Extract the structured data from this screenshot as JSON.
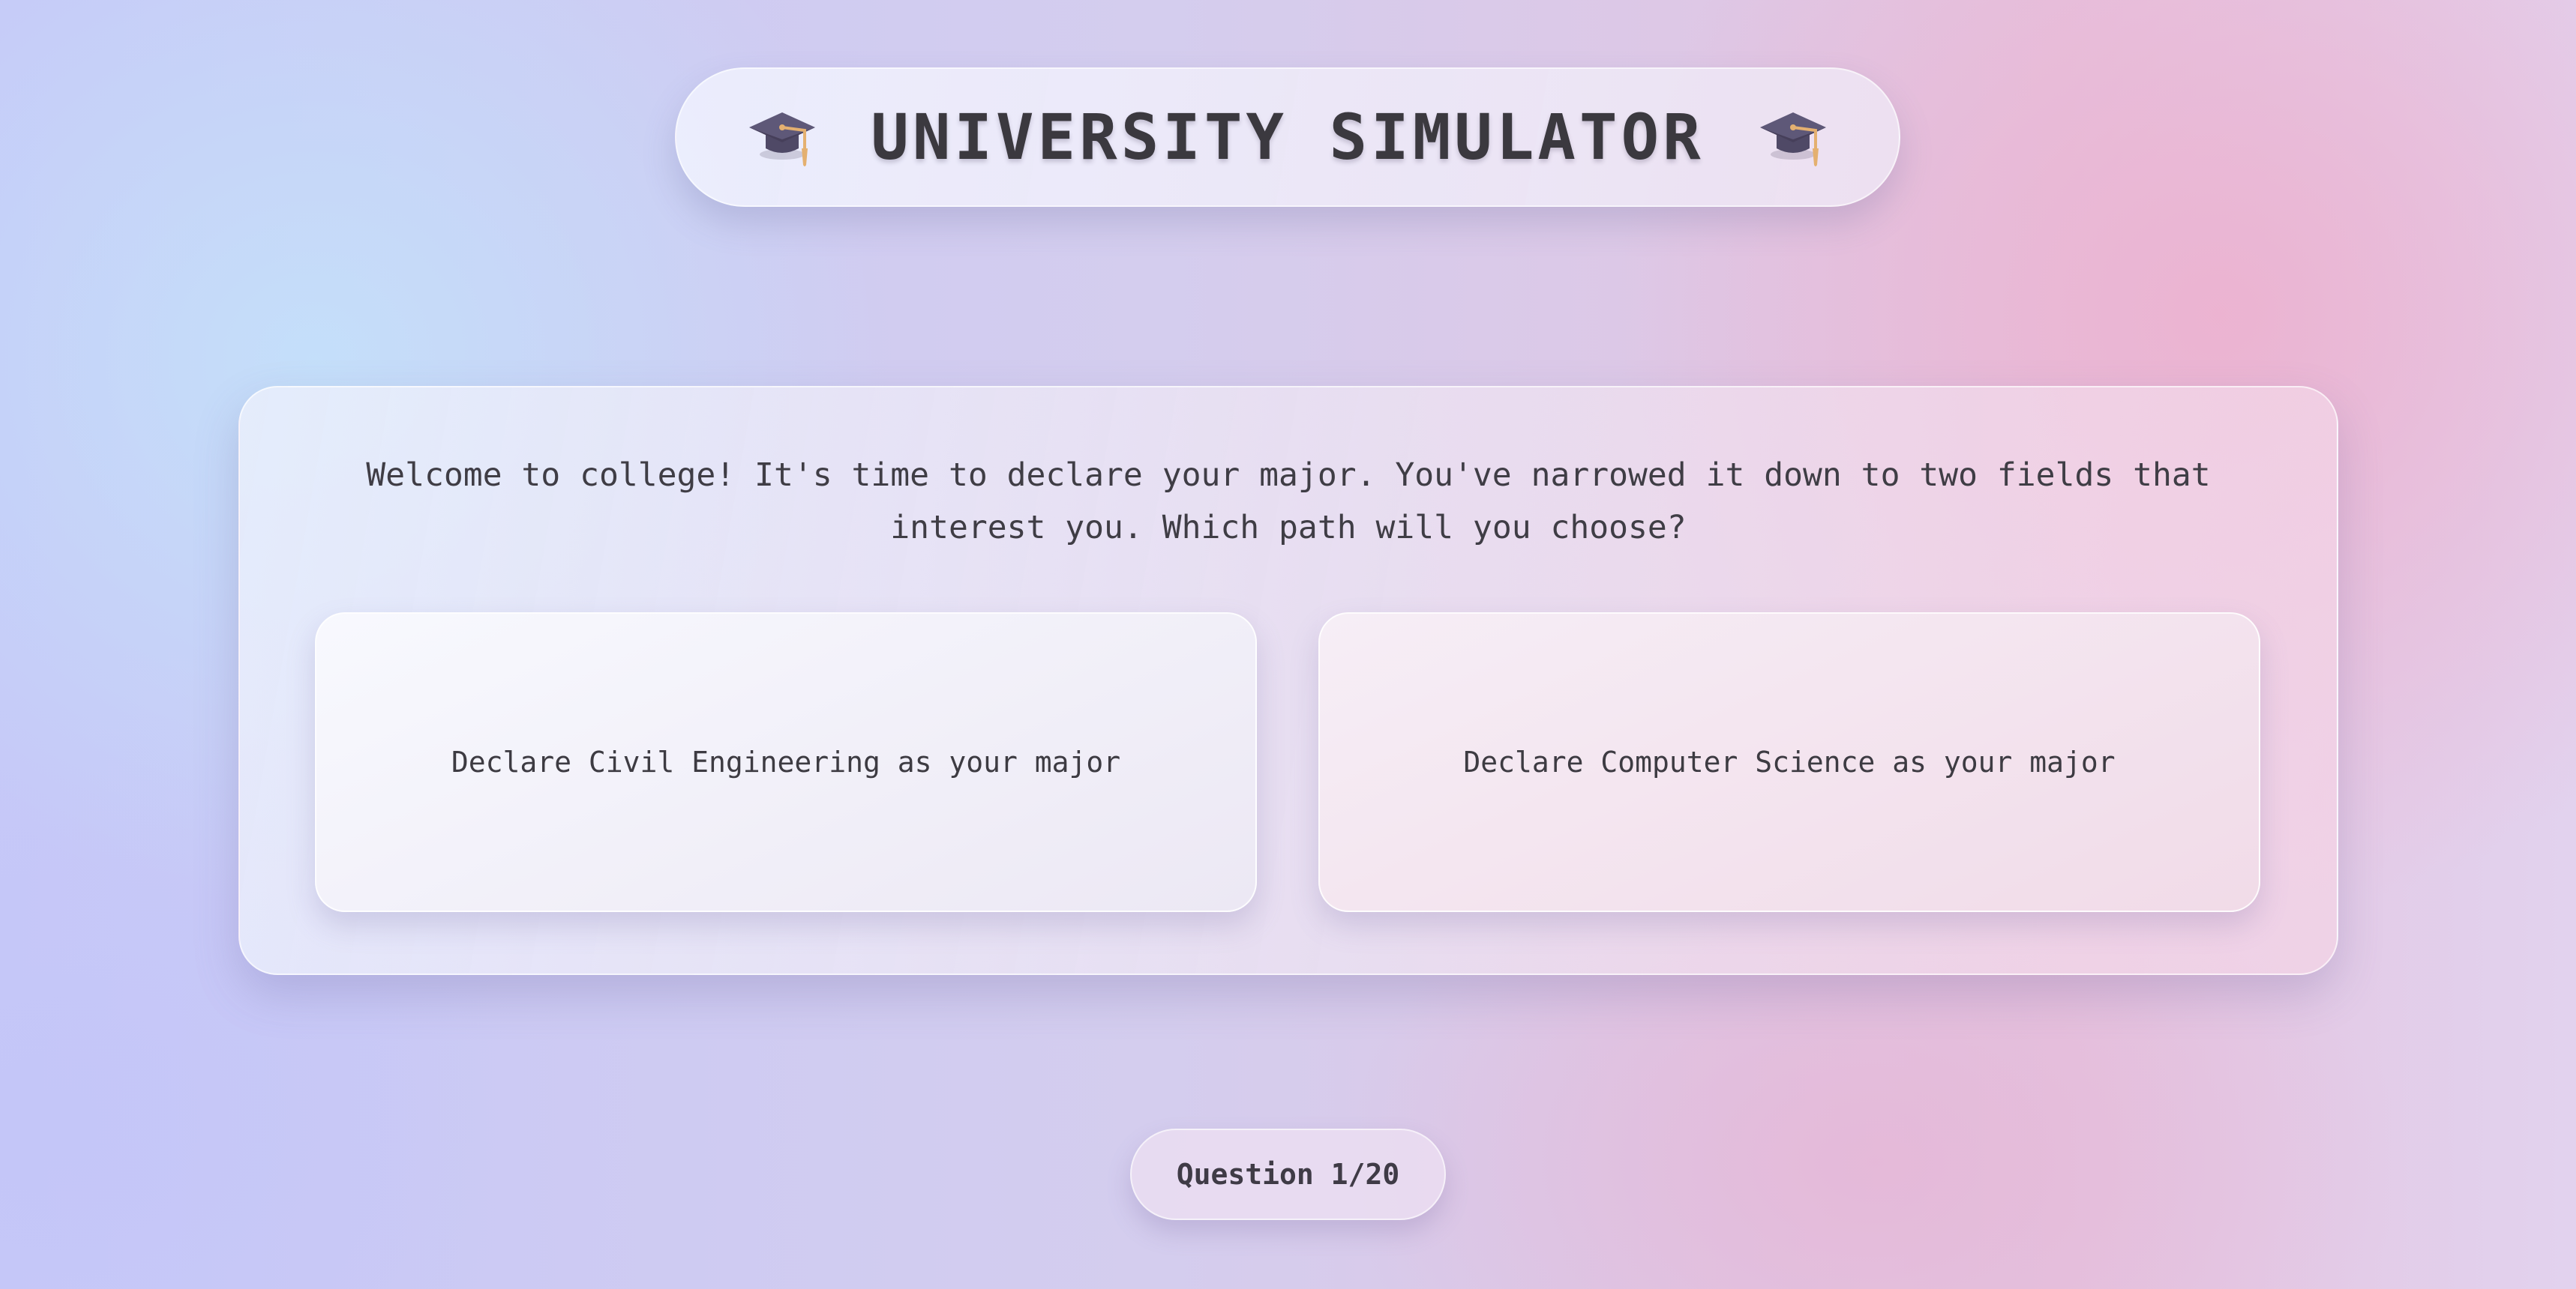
{
  "header": {
    "title": "UNIVERSITY SIMULATOR",
    "left_icon": "graduation-cap-icon",
    "right_icon": "graduation-cap-icon"
  },
  "question": {
    "text": "Welcome to college! It's time to declare your major. You've narrowed it down to two fields that interest you. Which path will you choose?",
    "choices": [
      {
        "label": "Declare Civil Engineering as your major"
      },
      {
        "label": "Declare Computer Science as your major"
      }
    ]
  },
  "progress": {
    "label": "Question 1/20",
    "current": 1,
    "total": 20
  },
  "colors": {
    "background_left": "#c6c8f8",
    "background_right": "#e4c4e0",
    "text": "#3c3a44",
    "cap": "#5a5470",
    "tassel": "#e4b070"
  }
}
